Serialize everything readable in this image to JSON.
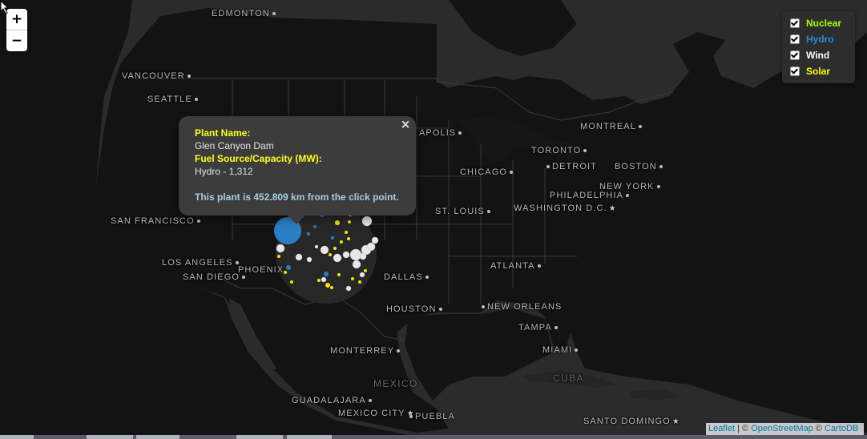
{
  "map": {
    "zoom_in_label": "+",
    "zoom_out_label": "−",
    "cities": [
      {
        "id": "edmonton",
        "name": "EDMONTON",
        "marker": "dot",
        "side": "right"
      },
      {
        "id": "vancouver",
        "name": "VANCOUVER",
        "marker": "dot",
        "side": "right"
      },
      {
        "id": "seattle",
        "name": "SEATTLE",
        "marker": "dot",
        "side": "right"
      },
      {
        "id": "montreal",
        "name": "MONTREAL",
        "marker": "dot",
        "side": "right"
      },
      {
        "id": "toronto",
        "name": "TORONTO",
        "marker": "dot",
        "side": "right"
      },
      {
        "id": "detroit",
        "name": "DETROIT",
        "marker": "dot",
        "side": "left"
      },
      {
        "id": "boston",
        "name": "BOSTON",
        "marker": "dot",
        "side": "right"
      },
      {
        "id": "chicago",
        "name": "CHICAGO",
        "marker": "dot",
        "side": "right"
      },
      {
        "id": "new-york",
        "name": "NEW YORK",
        "marker": "dot",
        "side": "right"
      },
      {
        "id": "philadelphia",
        "name": "PHILADELPHIA",
        "marker": "dot",
        "side": "right"
      },
      {
        "id": "washington",
        "name": "WASHINGTON D.C.",
        "marker": "star",
        "side": "right"
      },
      {
        "id": "minneapolis",
        "name": "APOLIS",
        "marker": "dot",
        "side": "right"
      },
      {
        "id": "st-louis",
        "name": "ST. LOUIS",
        "marker": "dot",
        "side": "right"
      },
      {
        "id": "san-francisco",
        "name": "SAN FRANCISCO",
        "marker": "dot",
        "side": "right"
      },
      {
        "id": "los-angeles",
        "name": "LOS ANGELES",
        "marker": "dot",
        "side": "right"
      },
      {
        "id": "san-diego",
        "name": "SAN DIEGO",
        "marker": "dot",
        "side": "right"
      },
      {
        "id": "phoenix",
        "name": "PHOENIX",
        "marker": "none",
        "side": "right"
      },
      {
        "id": "dallas",
        "name": "DALLAS",
        "marker": "dot",
        "side": "right"
      },
      {
        "id": "atlanta",
        "name": "ATLANTA",
        "marker": "dot",
        "side": "right"
      },
      {
        "id": "houston",
        "name": "HOUSTON",
        "marker": "dot",
        "side": "right"
      },
      {
        "id": "new-orleans",
        "name": "NEW ORLEANS",
        "marker": "dot",
        "side": "left"
      },
      {
        "id": "tampa",
        "name": "TAMPA",
        "marker": "dot",
        "side": "right"
      },
      {
        "id": "miami",
        "name": "MIAMI",
        "marker": "dot",
        "side": "right"
      },
      {
        "id": "monterrey",
        "name": "MONTERREY",
        "marker": "dot",
        "side": "right"
      },
      {
        "id": "guadalajara",
        "name": "GUADALAJARA",
        "marker": "dot",
        "side": "right"
      },
      {
        "id": "mexico-city",
        "name": "MEXICO CITY",
        "marker": "star",
        "side": "right"
      },
      {
        "id": "puebla",
        "name": "PUEBLA",
        "marker": "dot",
        "side": "left"
      },
      {
        "id": "santo-domingo",
        "name": "SANTO DOMINGO",
        "marker": "star",
        "side": "right"
      }
    ],
    "countries": [
      {
        "id": "mexico",
        "name": "MEXICO"
      },
      {
        "id": "cuba",
        "name": "CUBA"
      }
    ]
  },
  "layers": {
    "items": [
      {
        "id": "nuclear",
        "label": "Nuclear",
        "color": "#aaff00",
        "checked": true
      },
      {
        "id": "hydro",
        "label": "Hydro",
        "color": "#2f8ad0",
        "checked": true
      },
      {
        "id": "wind",
        "label": "Wind",
        "color": "#ffffff",
        "checked": true
      },
      {
        "id": "solar",
        "label": "Solar",
        "color": "#ffff00",
        "checked": true
      }
    ]
  },
  "popup": {
    "name_key": "Plant Name:",
    "name_value": "Glen Canyon Dam",
    "fuel_key": "Fuel Source/Capacity (MW):",
    "fuel_value": "Hydro - 1,312",
    "distance_text": "This plant is 452.809 km from the click point.",
    "close_label": "×"
  },
  "attribution": {
    "leaflet": "Leaflet",
    "sep1": " | © ",
    "osm": "OpenStreetMap",
    "sep2": " © ",
    "carto": "CartoDB"
  },
  "colors": {
    "hydro": "#2a7fc4",
    "wind": "#e8e8e8",
    "solar": "#f3e600",
    "land": "#2a2a2a",
    "water": "#131313"
  }
}
